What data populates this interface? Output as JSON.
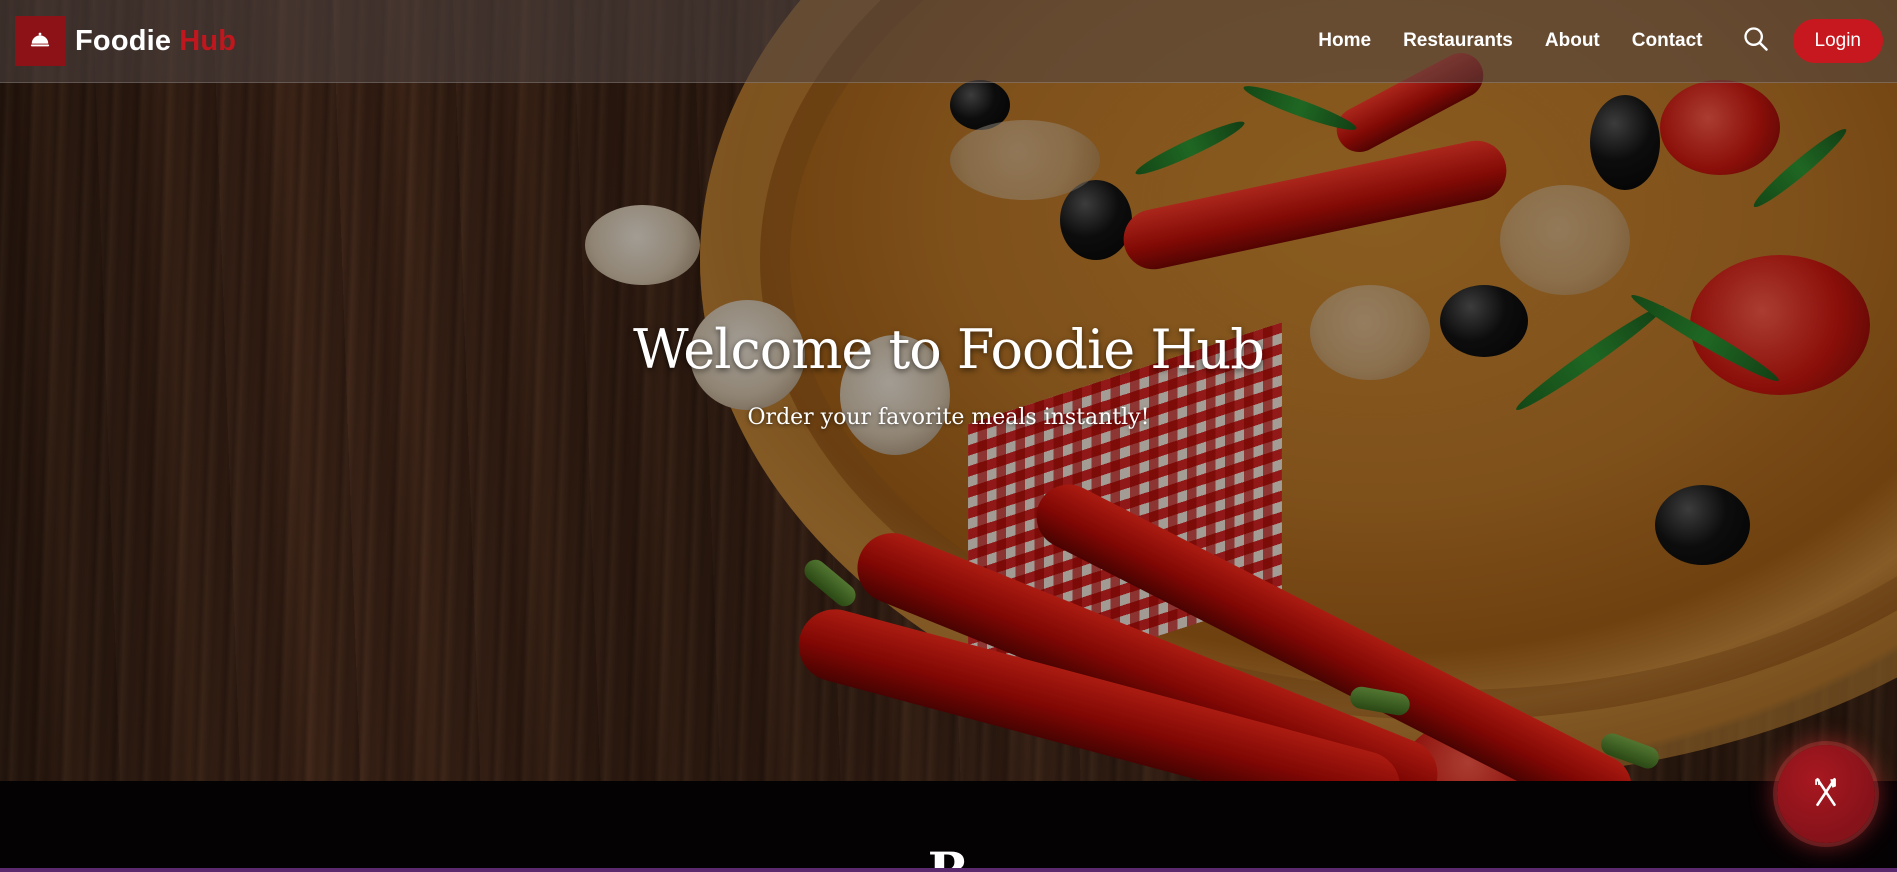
{
  "navbar": {
    "logo_icon": "cloche-icon",
    "brand_main": "Foodie",
    "brand_accent": "Hub",
    "links": [
      "Home",
      "Restaurants",
      "About",
      "Contact"
    ],
    "search_icon": "search-icon",
    "login_label": "Login"
  },
  "hero": {
    "title": "Welcome to Foodie Hub",
    "subtitle": "Order your favorite meals instantly!",
    "background": "pizza-on-wooden-table-photo"
  },
  "next_section": {
    "heading_partial": "R"
  },
  "fab": {
    "icon": "fork-knife-icon"
  },
  "colors": {
    "accent": "#c8181f",
    "logo_bg": "#8d1217",
    "section_bg": "#050204",
    "bottom_bar": "#5b2a6e"
  }
}
